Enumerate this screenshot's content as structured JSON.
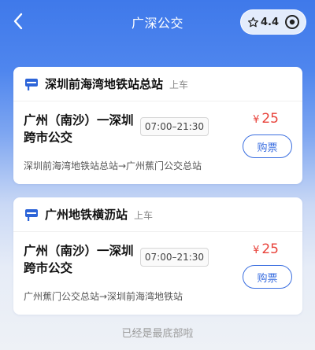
{
  "header": {
    "title": "广深公交",
    "back_icon": "chevron-left-icon",
    "rating": "4.4",
    "rating_icon": "star-outline-icon",
    "target_icon": "target-icon"
  },
  "stops": [
    {
      "name": "深圳前海湾地铁站总站",
      "tag": "上车",
      "icon": "bus-stop-icon",
      "route": {
        "name": "广州（南沙）一深圳跨市公交",
        "hours": "07:00–21:30",
        "currency": "¥",
        "price": "25",
        "buy_label": "购票",
        "path": "深圳前海湾地铁站总站→广州蕉门公交总站"
      }
    },
    {
      "name": "广州地铁横沥站",
      "tag": "上车",
      "icon": "bus-stop-icon",
      "route": {
        "name": "广州（南沙）一深圳跨市公交",
        "hours": "07:00–21:30",
        "currency": "¥",
        "price": "25",
        "buy_label": "购票",
        "path": "广州蕉门公交总站→深圳前海湾地铁站"
      }
    }
  ],
  "footer": {
    "end_note": "已经是最底部啦"
  },
  "colors": {
    "accent": "#3b6fe0",
    "price": "#e8423a",
    "header_bg": "#3f79ea"
  }
}
